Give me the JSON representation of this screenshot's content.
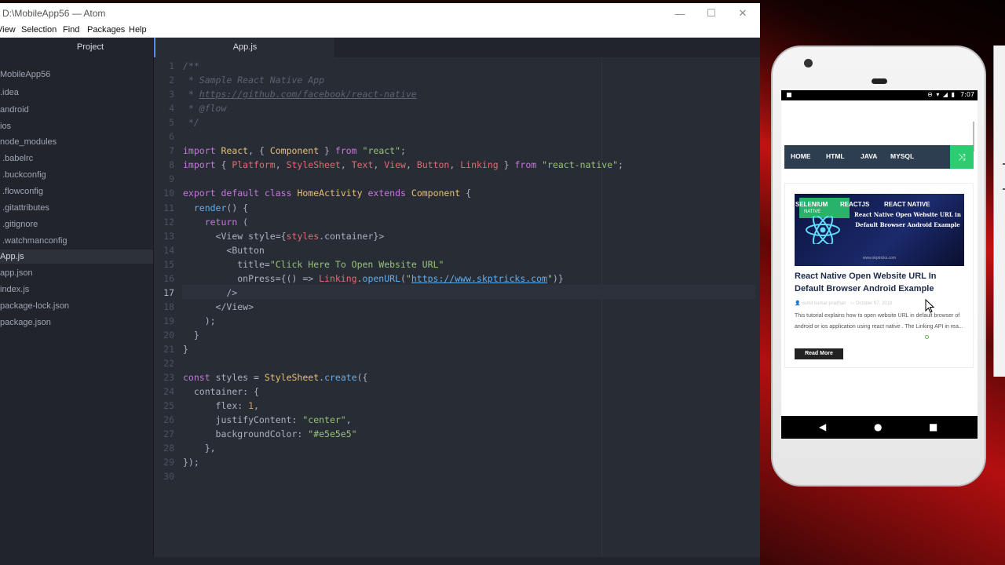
{
  "window": {
    "title": "D:\\MobileApp56 — Atom",
    "minimize_glyph": "—",
    "maximize_glyph": "☐",
    "close_glyph": "✕"
  },
  "menu": [
    "View",
    "Selection",
    "Find",
    "Packages",
    "Help"
  ],
  "tree": {
    "tab_label": "Project",
    "items": [
      "MobileApp56",
      ".idea",
      "android",
      "ios",
      "node_modules",
      ".babelrc",
      ".buckconfig",
      ".flowconfig",
      ".gitattributes",
      ".gitignore",
      ".watchmanconfig",
      "App.js",
      "app.json",
      "index.js",
      "package-lock.json",
      "package.json"
    ],
    "selected": "App.js"
  },
  "editor": {
    "tab_label": "App.js",
    "active_line": 17,
    "line_count": 30,
    "code_lines": [
      "/**",
      " * Sample React Native App",
      " * https://github.com/facebook/react-native",
      " * @flow",
      " */",
      "",
      "import React, { Component } from \"react\";",
      "import { Platform, StyleSheet, Text, View, Button, Linking } from \"react-native\";",
      "",
      "export default class HomeActivity extends Component {",
      "  render() {",
      "    return (",
      "      <View style={styles.container}>",
      "        <Button",
      "          title=\"Click Here To Open Website URL\"",
      "          onPress={() => Linking.openURL(\"https://www.skptricks.com\")}",
      "        />",
      "      </View>",
      "    );",
      "  }",
      "}",
      "",
      "const styles = StyleSheet.create({",
      "  container: {",
      "      flex: 1,",
      "      justifyContent: \"center\",",
      "      backgroundColor: \"#e5e5e5\"",
      "    },",
      "});",
      ""
    ]
  },
  "phone": {
    "status_time": "7:07",
    "status_icons": "⊖ ▾ ◢ ▮",
    "nav_links": [
      "HOME",
      "HTML",
      "JAVA",
      "MYSQL"
    ],
    "shuffle_icon": "⤨",
    "thumb_tags": [
      "SELENIUM",
      "REACTJS",
      "REACT NATIVE"
    ],
    "thumb_badge_sub": "NATIVE",
    "thumb_caption": "React Native Open Website URL in Default Browser Android Example",
    "thumb_footer": "www.skptricks.com",
    "post_title": "React Native Open Website URL In Default Browser Android Example",
    "post_author": "sumit kumar pradhan",
    "post_date": "October 07, 2018",
    "post_excerpt": "This tutorial explains how to open website URL in default browser of android or ios application using react native . The Linking API in rea...",
    "read_more": "Read More",
    "android_nav": [
      "◀",
      "●",
      "■"
    ]
  },
  "colors": {
    "editor_bg": "#282c34",
    "sidebar_bg": "#21252b",
    "nav_bg": "#2c3e50",
    "accent_green": "#2ecc71"
  }
}
